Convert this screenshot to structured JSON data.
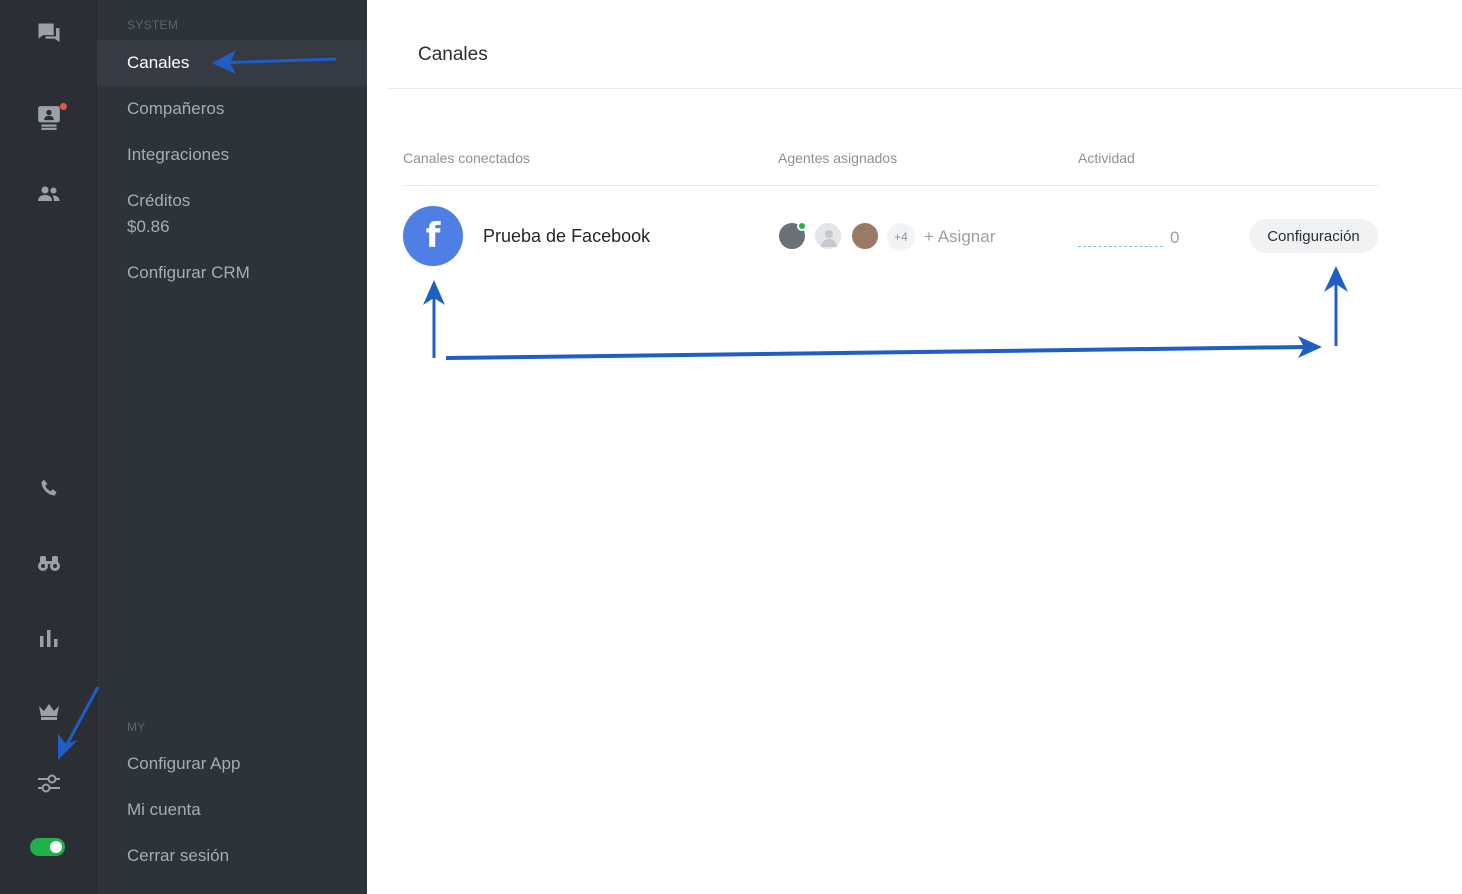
{
  "sidebar": {
    "system_label": "SYSTEM",
    "my_label": "MY",
    "system_items": [
      {
        "label": "Canales",
        "active": true
      },
      {
        "label": "Compañeros"
      },
      {
        "label": "Integraciones"
      },
      {
        "label": "Créditos",
        "sub": "$0.86"
      },
      {
        "label": "Configurar CRM"
      }
    ],
    "my_items": [
      {
        "label": "Configurar App"
      },
      {
        "label": "Mi cuenta"
      },
      {
        "label": "Cerrar sesión"
      }
    ]
  },
  "rail_icons": [
    "chat-icon",
    "monitor-user-icon",
    "people-icon",
    "phone-icon",
    "binoculars-icon",
    "bar-chart-icon",
    "crown-icon",
    "sliders-icon"
  ],
  "status_toggle": {
    "on": true,
    "color": "#22b04b"
  },
  "main": {
    "title": "Canales",
    "columns": [
      "Canales conectados",
      "Agentes asignados",
      "Actividad"
    ],
    "row": {
      "icon": "facebook-icon",
      "icon_glyph": "f",
      "name": "Prueba de Facebook",
      "extra_agents": "+4",
      "assign_label": "+ Asignar",
      "activity_value": "0",
      "config_label": "Configuración"
    }
  },
  "colors": {
    "rail_bg": "#2b2f35",
    "menu_bg": "#2e3239",
    "active_item_bg": "#363b43",
    "facebook_blue": "#4f7ee4",
    "annotation_arrow": "#1f5fc4",
    "online": "#22b04b"
  }
}
